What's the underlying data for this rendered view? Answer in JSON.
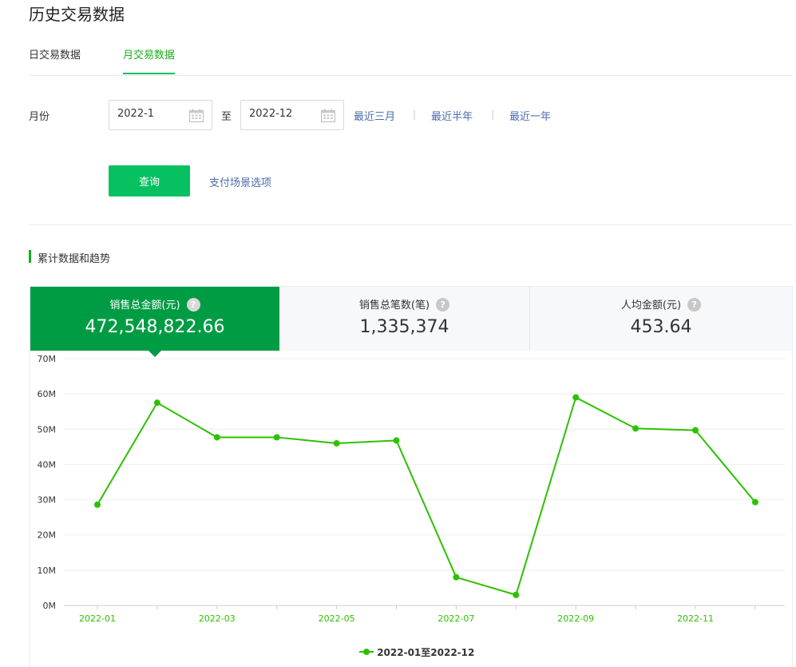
{
  "page": {
    "title": "历史交易数据"
  },
  "tabs": [
    {
      "label": "日交易数据",
      "active": false
    },
    {
      "label": "月交易数据",
      "active": true
    }
  ],
  "filter": {
    "month_label": "月份",
    "start_value": "2022-1",
    "end_value": "2022-12",
    "to_label": "至",
    "quick_ranges": [
      "最近三月",
      "最近半年",
      "最近一年"
    ],
    "query_label": "查询",
    "scene_link": "支付场景选项"
  },
  "section": {
    "title": "累计数据和趋势"
  },
  "cards": [
    {
      "label": "销售总金额(元)",
      "value": "472,548,822.66",
      "active": true
    },
    {
      "label": "销售总笔数(笔)",
      "value": "1,335,374",
      "active": false
    },
    {
      "label": "人均金额(元)",
      "value": "453.64",
      "active": false
    }
  ],
  "colors": {
    "accent": "#07c160",
    "active_card": "#009c44",
    "line": "#2dc100",
    "link": "#4a6dac"
  },
  "chart_data": {
    "type": "line",
    "x": [
      "2022-01",
      "2022-02",
      "2022-03",
      "2022-04",
      "2022-05",
      "2022-06",
      "2022-07",
      "2022-08",
      "2022-09",
      "2022-10",
      "2022-11",
      "2022-12"
    ],
    "x_tick_labels": [
      "2022-01",
      "2022-03",
      "2022-05",
      "2022-07",
      "2022-09",
      "2022-11"
    ],
    "series": [
      {
        "name": "2022-01至2022-12",
        "values": [
          28.6,
          57.5,
          47.7,
          47.7,
          46.0,
          46.8,
          8.0,
          3.0,
          59.0,
          50.2,
          49.7,
          29.3
        ]
      }
    ],
    "y_unit": "M",
    "ylim": [
      0,
      70
    ],
    "y_ticks": [
      "0M",
      "10M",
      "20M",
      "30M",
      "40M",
      "50M",
      "60M",
      "70M"
    ],
    "grid": true,
    "legend": "bottom-center"
  }
}
